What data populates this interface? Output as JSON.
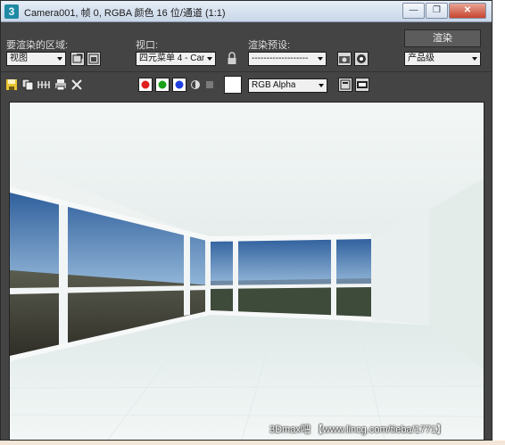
{
  "window": {
    "title": "Camera001, 帧 0, RGBA 颜色 16 位/通道 (1:1)",
    "icon_glyph": "3",
    "minimize_glyph": "—",
    "restore_glyph": "❐",
    "close_glyph": "✕"
  },
  "controls": {
    "area_label": "要渲染的区域:",
    "area_value": "视图",
    "viewport_label": "视口:",
    "viewport_value": "四元菜单 4 - Can",
    "preset_label": "渲染预设:",
    "preset_value": "-------------------",
    "render_button": "渲染",
    "quality_value": "产品级"
  },
  "toolbar": {
    "channel_value": "RGB Alpha",
    "channel_colors": {
      "red": "#e02020",
      "green": "#1aa01a",
      "blue": "#1f3fe0"
    },
    "swatch_color": "#ffffff"
  },
  "watermark": "3Dmax吧 【www.lincg.com/tieba/1771】",
  "icons": {
    "area_edit": "crop-edit-icon",
    "area_region": "region-select-icon",
    "lock": "lock-icon",
    "render_setup": "render-setup-icon",
    "environment": "environment-icon",
    "save": "save-image-icon",
    "copy": "copy-image-icon",
    "clone": "clone-window-icon",
    "print": "print-icon",
    "clear": "clear-icon",
    "mono": "monochrome-icon",
    "alpha": "alpha-icon",
    "info_panel": "info-panel-icon",
    "lut": "lut-icon"
  }
}
